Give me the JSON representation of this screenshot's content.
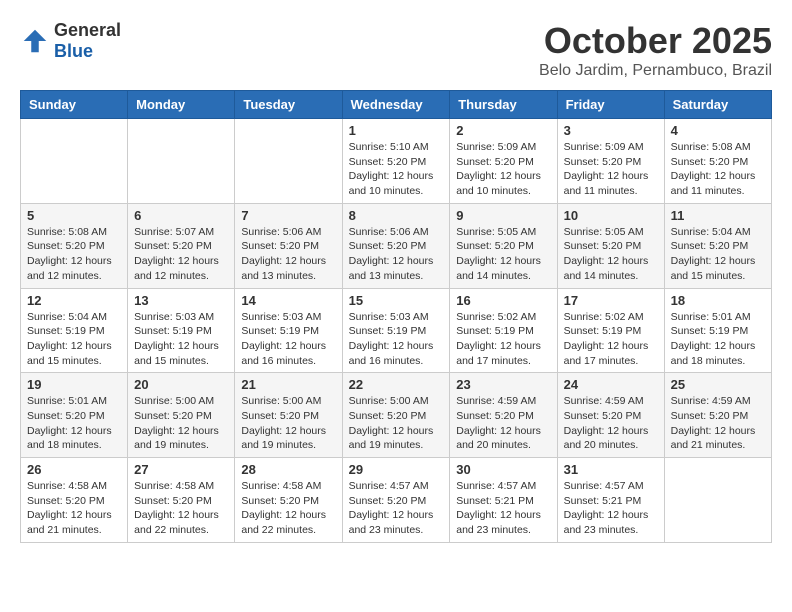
{
  "logo": {
    "general": "General",
    "blue": "Blue"
  },
  "title": "October 2025",
  "location": "Belo Jardim, Pernambuco, Brazil",
  "days_of_week": [
    "Sunday",
    "Monday",
    "Tuesday",
    "Wednesday",
    "Thursday",
    "Friday",
    "Saturday"
  ],
  "weeks": [
    [
      {
        "day": "",
        "info": ""
      },
      {
        "day": "",
        "info": ""
      },
      {
        "day": "",
        "info": ""
      },
      {
        "day": "1",
        "info": "Sunrise: 5:10 AM\nSunset: 5:20 PM\nDaylight: 12 hours\nand 10 minutes."
      },
      {
        "day": "2",
        "info": "Sunrise: 5:09 AM\nSunset: 5:20 PM\nDaylight: 12 hours\nand 10 minutes."
      },
      {
        "day": "3",
        "info": "Sunrise: 5:09 AM\nSunset: 5:20 PM\nDaylight: 12 hours\nand 11 minutes."
      },
      {
        "day": "4",
        "info": "Sunrise: 5:08 AM\nSunset: 5:20 PM\nDaylight: 12 hours\nand 11 minutes."
      }
    ],
    [
      {
        "day": "5",
        "info": "Sunrise: 5:08 AM\nSunset: 5:20 PM\nDaylight: 12 hours\nand 12 minutes."
      },
      {
        "day": "6",
        "info": "Sunrise: 5:07 AM\nSunset: 5:20 PM\nDaylight: 12 hours\nand 12 minutes."
      },
      {
        "day": "7",
        "info": "Sunrise: 5:06 AM\nSunset: 5:20 PM\nDaylight: 12 hours\nand 13 minutes."
      },
      {
        "day": "8",
        "info": "Sunrise: 5:06 AM\nSunset: 5:20 PM\nDaylight: 12 hours\nand 13 minutes."
      },
      {
        "day": "9",
        "info": "Sunrise: 5:05 AM\nSunset: 5:20 PM\nDaylight: 12 hours\nand 14 minutes."
      },
      {
        "day": "10",
        "info": "Sunrise: 5:05 AM\nSunset: 5:20 PM\nDaylight: 12 hours\nand 14 minutes."
      },
      {
        "day": "11",
        "info": "Sunrise: 5:04 AM\nSunset: 5:20 PM\nDaylight: 12 hours\nand 15 minutes."
      }
    ],
    [
      {
        "day": "12",
        "info": "Sunrise: 5:04 AM\nSunset: 5:19 PM\nDaylight: 12 hours\nand 15 minutes."
      },
      {
        "day": "13",
        "info": "Sunrise: 5:03 AM\nSunset: 5:19 PM\nDaylight: 12 hours\nand 15 minutes."
      },
      {
        "day": "14",
        "info": "Sunrise: 5:03 AM\nSunset: 5:19 PM\nDaylight: 12 hours\nand 16 minutes."
      },
      {
        "day": "15",
        "info": "Sunrise: 5:03 AM\nSunset: 5:19 PM\nDaylight: 12 hours\nand 16 minutes."
      },
      {
        "day": "16",
        "info": "Sunrise: 5:02 AM\nSunset: 5:19 PM\nDaylight: 12 hours\nand 17 minutes."
      },
      {
        "day": "17",
        "info": "Sunrise: 5:02 AM\nSunset: 5:19 PM\nDaylight: 12 hours\nand 17 minutes."
      },
      {
        "day": "18",
        "info": "Sunrise: 5:01 AM\nSunset: 5:19 PM\nDaylight: 12 hours\nand 18 minutes."
      }
    ],
    [
      {
        "day": "19",
        "info": "Sunrise: 5:01 AM\nSunset: 5:20 PM\nDaylight: 12 hours\nand 18 minutes."
      },
      {
        "day": "20",
        "info": "Sunrise: 5:00 AM\nSunset: 5:20 PM\nDaylight: 12 hours\nand 19 minutes."
      },
      {
        "day": "21",
        "info": "Sunrise: 5:00 AM\nSunset: 5:20 PM\nDaylight: 12 hours\nand 19 minutes."
      },
      {
        "day": "22",
        "info": "Sunrise: 5:00 AM\nSunset: 5:20 PM\nDaylight: 12 hours\nand 19 minutes."
      },
      {
        "day": "23",
        "info": "Sunrise: 4:59 AM\nSunset: 5:20 PM\nDaylight: 12 hours\nand 20 minutes."
      },
      {
        "day": "24",
        "info": "Sunrise: 4:59 AM\nSunset: 5:20 PM\nDaylight: 12 hours\nand 20 minutes."
      },
      {
        "day": "25",
        "info": "Sunrise: 4:59 AM\nSunset: 5:20 PM\nDaylight: 12 hours\nand 21 minutes."
      }
    ],
    [
      {
        "day": "26",
        "info": "Sunrise: 4:58 AM\nSunset: 5:20 PM\nDaylight: 12 hours\nand 21 minutes."
      },
      {
        "day": "27",
        "info": "Sunrise: 4:58 AM\nSunset: 5:20 PM\nDaylight: 12 hours\nand 22 minutes."
      },
      {
        "day": "28",
        "info": "Sunrise: 4:58 AM\nSunset: 5:20 PM\nDaylight: 12 hours\nand 22 minutes."
      },
      {
        "day": "29",
        "info": "Sunrise: 4:57 AM\nSunset: 5:20 PM\nDaylight: 12 hours\nand 23 minutes."
      },
      {
        "day": "30",
        "info": "Sunrise: 4:57 AM\nSunset: 5:21 PM\nDaylight: 12 hours\nand 23 minutes."
      },
      {
        "day": "31",
        "info": "Sunrise: 4:57 AM\nSunset: 5:21 PM\nDaylight: 12 hours\nand 23 minutes."
      },
      {
        "day": "",
        "info": ""
      }
    ]
  ]
}
